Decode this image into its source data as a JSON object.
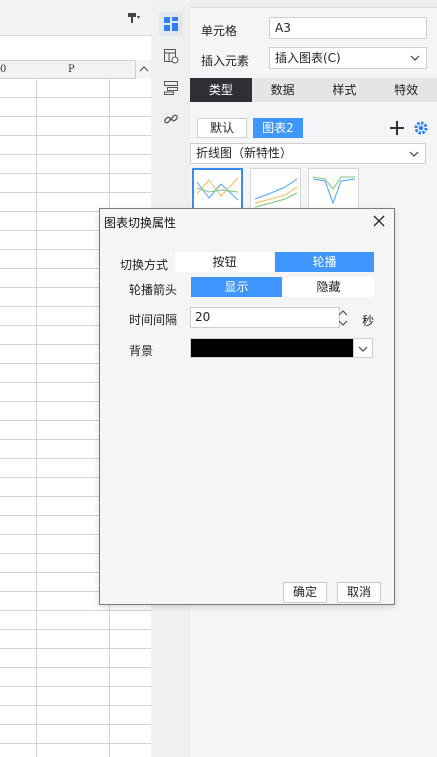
{
  "sheet": {
    "columns": [
      "0",
      "P"
    ]
  },
  "panel": {
    "cell_label": "单元格",
    "cell_value": "A3",
    "insert_label": "插入元素",
    "insert_value": "插入图表(C)",
    "tabs": [
      {
        "label": "类型",
        "active": true
      },
      {
        "label": "数据",
        "active": false
      },
      {
        "label": "样式",
        "active": false
      },
      {
        "label": "特效",
        "active": false
      }
    ],
    "chart_tabs": [
      "默认",
      "图表2"
    ],
    "chart_type_select": "折线图（新特性）",
    "add_icon": "plus-icon",
    "settings_icon": "gear-icon"
  },
  "dialog": {
    "title": "图表切换属性",
    "switch_mode_label": "切换方式",
    "switch_mode_options": [
      "按钮",
      "轮播"
    ],
    "switch_mode_selected": "轮播",
    "arrow_label": "轮播箭头",
    "arrow_options": [
      "显示",
      "隐藏"
    ],
    "arrow_selected": "显示",
    "interval_label": "时间间隔",
    "interval_value": "20",
    "interval_unit": "秒",
    "background_label": "背景",
    "background_color": "#000000",
    "ok_label": "确定",
    "cancel_label": "取消"
  },
  "colors": {
    "accent": "#4096ff",
    "active_tab": "#2f2f36"
  }
}
